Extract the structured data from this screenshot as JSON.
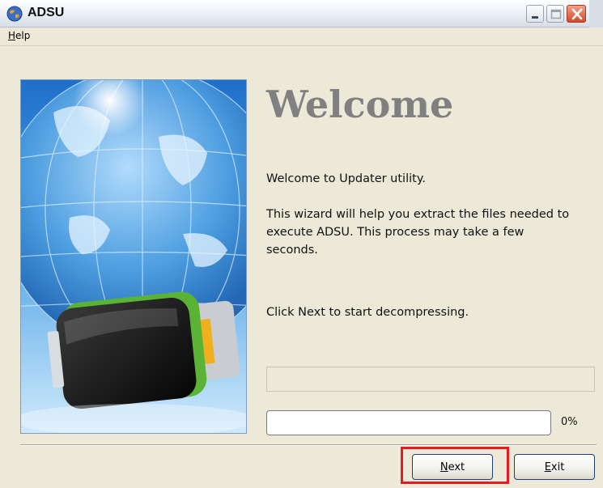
{
  "window": {
    "title": "ADSU",
    "icon": "globe-app-icon"
  },
  "titlebar_buttons": [
    "minimize-icon",
    "maximize-icon",
    "close-icon"
  ],
  "menu": {
    "items": [
      {
        "label": "Help",
        "mnemonic": "H"
      }
    ]
  },
  "banner": {
    "image": "globe-and-usb-device-illustration"
  },
  "content": {
    "heading": "Welcome",
    "intro": "Welcome to Updater utility.",
    "description": "This wizard will help you extract the files needed to execute ADSU. This process may take a few seconds.",
    "instruction": "Click Next to start decompressing.",
    "status_text": ""
  },
  "progress": {
    "value": 0,
    "label": "0%"
  },
  "buttons": {
    "next": {
      "label": "Next",
      "mnemonic": "N"
    },
    "exit": {
      "label": "Exit",
      "mnemonic": "E"
    }
  },
  "annotation": {
    "highlight_color": "#e8191f",
    "highlighted": "next-button"
  }
}
